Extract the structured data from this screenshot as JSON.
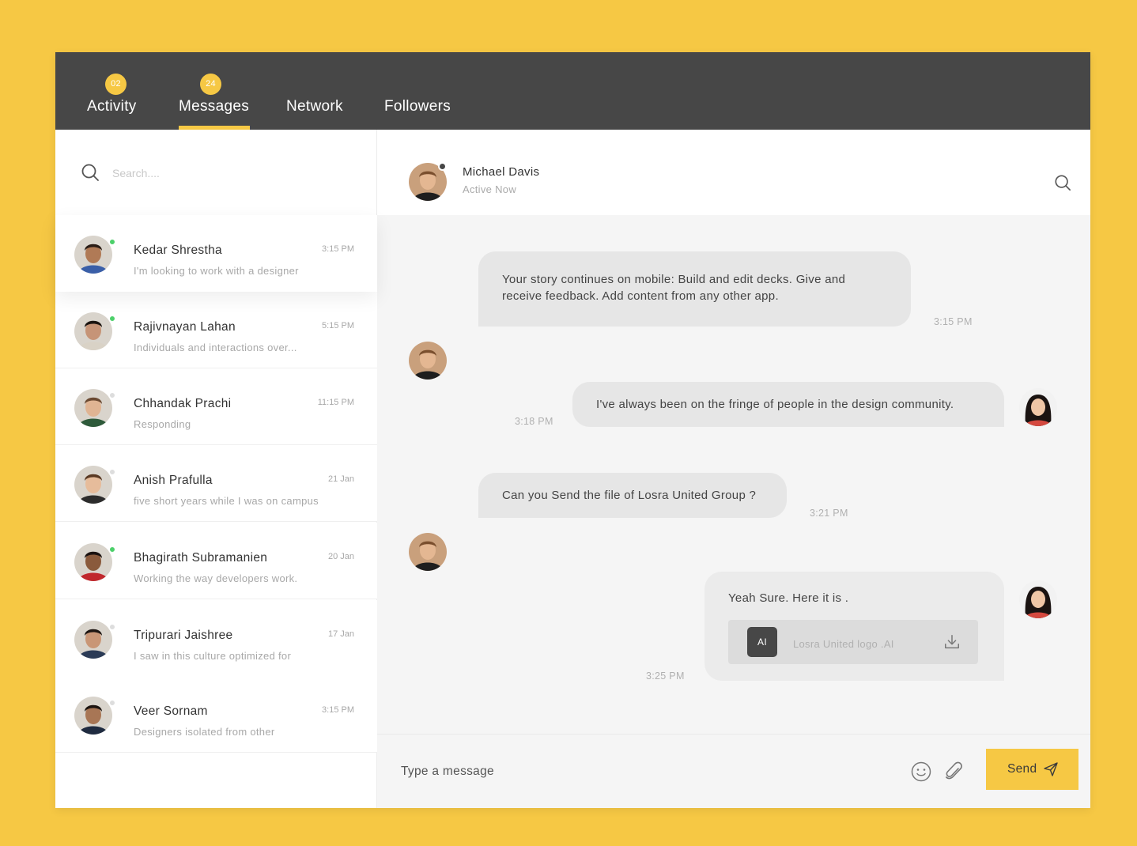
{
  "nav": {
    "tabs": [
      {
        "label": "Activity",
        "badge": "02"
      },
      {
        "label": "Messages",
        "badge": "24",
        "active": true
      },
      {
        "label": "Network"
      },
      {
        "label": "Followers"
      }
    ]
  },
  "sidebar": {
    "search_placeholder": "Search....",
    "contacts": [
      {
        "name": "Kedar Shrestha",
        "preview": "I'm looking to work with a designer",
        "time": "3:15 PM",
        "online": true,
        "active": true,
        "skin": "#b07a56",
        "hair": "#2a1d16",
        "shirt": "#3a5fa8"
      },
      {
        "name": "Rajivnayan Lahan",
        "preview": "Individuals and interactions over...",
        "time": "5:15 PM",
        "online": true,
        "skin": "#c69477",
        "hair": "#1a1410",
        "shirt": "#d9d2c6"
      },
      {
        "name": "Chhandak Prachi",
        "preview": "Responding",
        "time": "11:15 PM",
        "online": false,
        "skin": "#e0b493",
        "hair": "#6b4a32",
        "shirt": "#2e5a3a"
      },
      {
        "name": "Anish Prafulla",
        "preview": "five short years while I was on campus",
        "time": "21 Jan",
        "online": false,
        "skin": "#e6bc9b",
        "hair": "#5a3a24",
        "shirt": "#2c2c2c"
      },
      {
        "name": "Bhagirath Subramanien",
        "preview": "Working the way developers work.",
        "time": "20 Jan",
        "online": true,
        "skin": "#8a5a3c",
        "hair": "#1a1210",
        "shirt": "#c0282d"
      },
      {
        "name": "Tripurari Jaishree",
        "preview": "I saw in this culture optimized for",
        "time": "17 Jan",
        "online": false,
        "skin": "#c99676",
        "hair": "#1e1612",
        "shirt": "#2b3b56"
      },
      {
        "name": "Veer Sornam",
        "preview": "Designers isolated from other",
        "time": "3:15 PM",
        "online": false,
        "skin": "#a87655",
        "hair": "#1c1410",
        "shirt": "#1f2b40"
      }
    ]
  },
  "chat": {
    "contact_name": "Michael Davis",
    "contact_status": "Active Now",
    "messages": [
      {
        "text": "Your story continues on mobile: Build and edit decks. Give and receive feedback. Add content from any other app.",
        "time": "3:15 PM"
      },
      {
        "text": "I've always been on the fringe of people in the design community.",
        "time": "3:18 PM"
      },
      {
        "text": "Can you Send the file of Losra United Group ?",
        "time": "3:21 PM"
      },
      {
        "text": "Yeah Sure. Here it is .",
        "time": "3:25 PM",
        "file_icon": "AI",
        "file_name": "Losra United logo .AI"
      }
    ],
    "composer_placeholder": "Type a message",
    "send_label": "Send"
  },
  "colors": {
    "accent": "#F6C844",
    "nav_bg": "#474747",
    "online": "#4cd06a",
    "bubble": "#e6e6e6"
  },
  "icons": [
    "search-icon",
    "smiley-icon",
    "paperclip-icon",
    "send-icon",
    "download-icon"
  ]
}
